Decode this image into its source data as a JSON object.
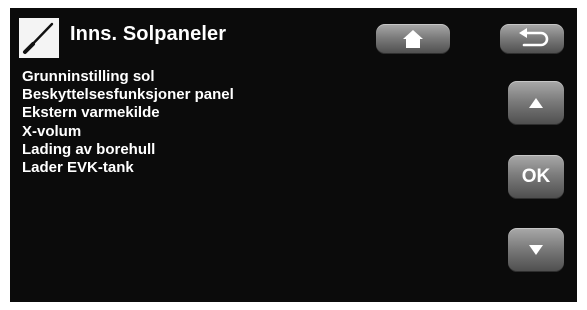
{
  "header": {
    "title": "Inns. Solpaneler",
    "icon": "screwdriver-icon"
  },
  "toolbar": {
    "home_icon": "home-icon",
    "back_icon": "back-arrow-icon"
  },
  "menu": {
    "items": [
      {
        "label": "Grunninstilling sol"
      },
      {
        "label": "Beskyttelsesfunksjoner panel"
      },
      {
        "label": "Ekstern varmekilde"
      },
      {
        "label": "X-volum"
      },
      {
        "label": "Lading av borehull"
      },
      {
        "label": "Lader EVK-tank"
      }
    ]
  },
  "nav": {
    "up_icon": "triangle-up-icon",
    "ok_label": "OK",
    "down_icon": "triangle-down-icon"
  },
  "colors": {
    "background": "#0b0b0b",
    "text": "#ffffff",
    "button_gradient_top": "#a9a9a9",
    "button_gradient_bottom": "#4d4d4d"
  }
}
